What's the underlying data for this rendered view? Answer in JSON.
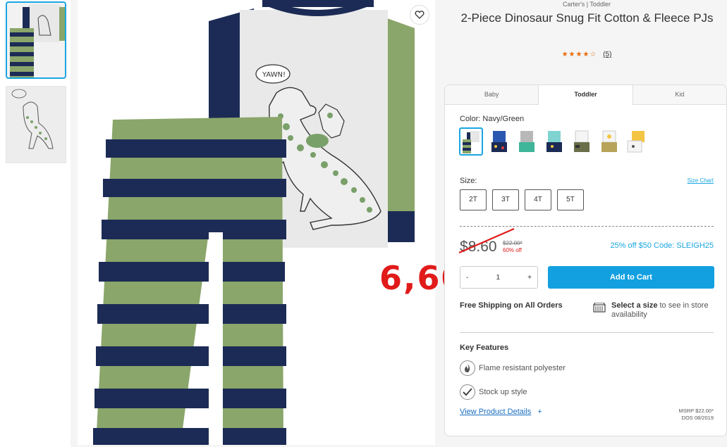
{
  "product": {
    "brand_path": "Carter's | Toddler",
    "title": "2-Piece Dinosaur Snug Fit Cotton & Fleece PJs",
    "rating_stars": "★★★★☆",
    "review_count": "(5)"
  },
  "overlay": {
    "annotation": "6,60",
    "color": "#e11a1a"
  },
  "tabs": [
    {
      "label": "Baby"
    },
    {
      "label": "Toddler"
    },
    {
      "label": "Kid"
    }
  ],
  "color": {
    "label": "Color:",
    "value": "Navy/Green"
  },
  "size": {
    "label": "Size:",
    "chart_link": "Size Chart",
    "options": [
      "2T",
      "3T",
      "4T",
      "5T"
    ]
  },
  "pricing": {
    "current": "$8.60",
    "original": "$22.00*",
    "discount": "60% off",
    "promo": "25% off $50 Code: SLEIGH25"
  },
  "cart": {
    "qty_minus": "-",
    "qty_value": "1",
    "qty_plus": "+",
    "add_label": "Add to Cart"
  },
  "shipping": {
    "free_label": "Free Shipping on All Orders",
    "store_bold": "Select a size",
    "store_rest": " to see in store availability"
  },
  "features": {
    "title": "Key Features",
    "items": [
      "Flame resistant polyester",
      "Stock up style"
    ]
  },
  "footer": {
    "details_link": "View Product Details",
    "details_plus": "+",
    "msrp": "MSRP $22.00*",
    "dos": "DOS 08/2019"
  },
  "colors": {
    "accent": "#13a0e0",
    "navy": "#1c2b55",
    "green": "#8aa66a",
    "star": "#e96b0e"
  }
}
